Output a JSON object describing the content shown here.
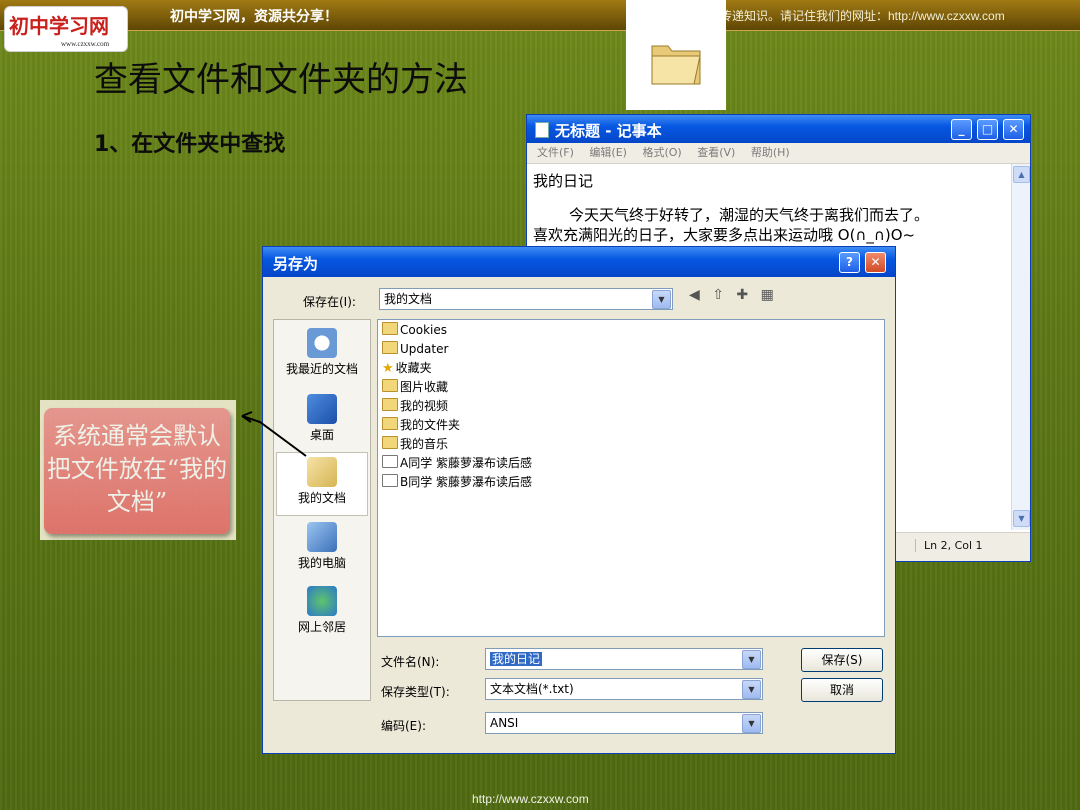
{
  "header": {
    "logo_text": "初中学习网",
    "logo_url": "www.czxxw.com",
    "slogan": "初中学习网，资源共分享！",
    "right_text": "传递知识。请记住我们的网址：http://www.czxxw.com"
  },
  "slide": {
    "title": "查看文件和文件夹的方法",
    "subtitle": "1、在文件夹中查找",
    "callout": "系统通常会默认把文件放在“我的文档”",
    "footer_url": "http://www.czxxw.com"
  },
  "notepad": {
    "title": "无标题 - 记事本",
    "menu": [
      "文件(F)",
      "编辑(E)",
      "格式(O)",
      "查看(V)",
      "帮助(H)"
    ],
    "line1": "我的日记",
    "line2": "今天天气终于好转了，潮湿的天气终于离我们而去了。",
    "line3": "喜欢充满阳光的日子，大家要多点出来运动哦 O(∩_∩)O~",
    "status": "Ln 2, Col 1"
  },
  "dialog": {
    "title": "另存为",
    "save_in_label": "保存在(I):",
    "save_in_value": "我的文档",
    "places": [
      "我最近的文档",
      "桌面",
      "我的文档",
      "我的电脑",
      "网上邻居"
    ],
    "files": [
      "Cookies",
      "Updater",
      "收藏夹",
      "图片收藏",
      "我的视频",
      "我的文件夹",
      "我的音乐",
      "A同学 紫藤萝瀑布读后感",
      "B同学 紫藤萝瀑布读后感"
    ],
    "filename_label": "文件名(N):",
    "filename_value": "我的日记",
    "filetype_label": "保存类型(T):",
    "filetype_value": "文本文档(*.txt)",
    "encoding_label": "编码(E):",
    "encoding_value": "ANSI",
    "save_button": "保存(S)",
    "cancel_button": "取消"
  }
}
